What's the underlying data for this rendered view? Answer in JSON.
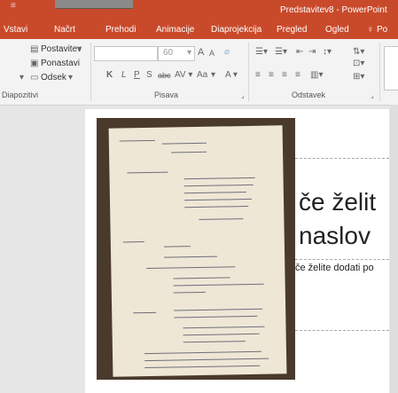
{
  "window": {
    "title": "Predstavitev8 - PowerPoint"
  },
  "tabs": [
    "Vstavi",
    "Načrt",
    "Prehodi",
    "Animacije",
    "Diaprojekcija",
    "Pregled",
    "Ogled",
    "Po"
  ],
  "ribbon": {
    "slides_group": {
      "label": "Diapozitivi",
      "layout_label": "Postavitev",
      "reset_label": "Ponastavi",
      "section_label": "Odsek"
    },
    "font_group": {
      "label": "Pisava",
      "font_size": "60",
      "bold": "K",
      "italic": "L",
      "underline": "P",
      "strike": "S",
      "spacing": "abc",
      "grow": "A",
      "shrink": "A",
      "change_case": "Aa"
    },
    "paragraph_group": {
      "label": "Odstavek"
    }
  },
  "slide": {
    "title_line1": "če želit",
    "title_line2": "naslov",
    "subtitle": "če želite dodati po"
  },
  "colors": {
    "accent": "#c94a2b",
    "ribbon_bg": "#f3f3f3",
    "canvas_bg": "#e6e6e6"
  }
}
